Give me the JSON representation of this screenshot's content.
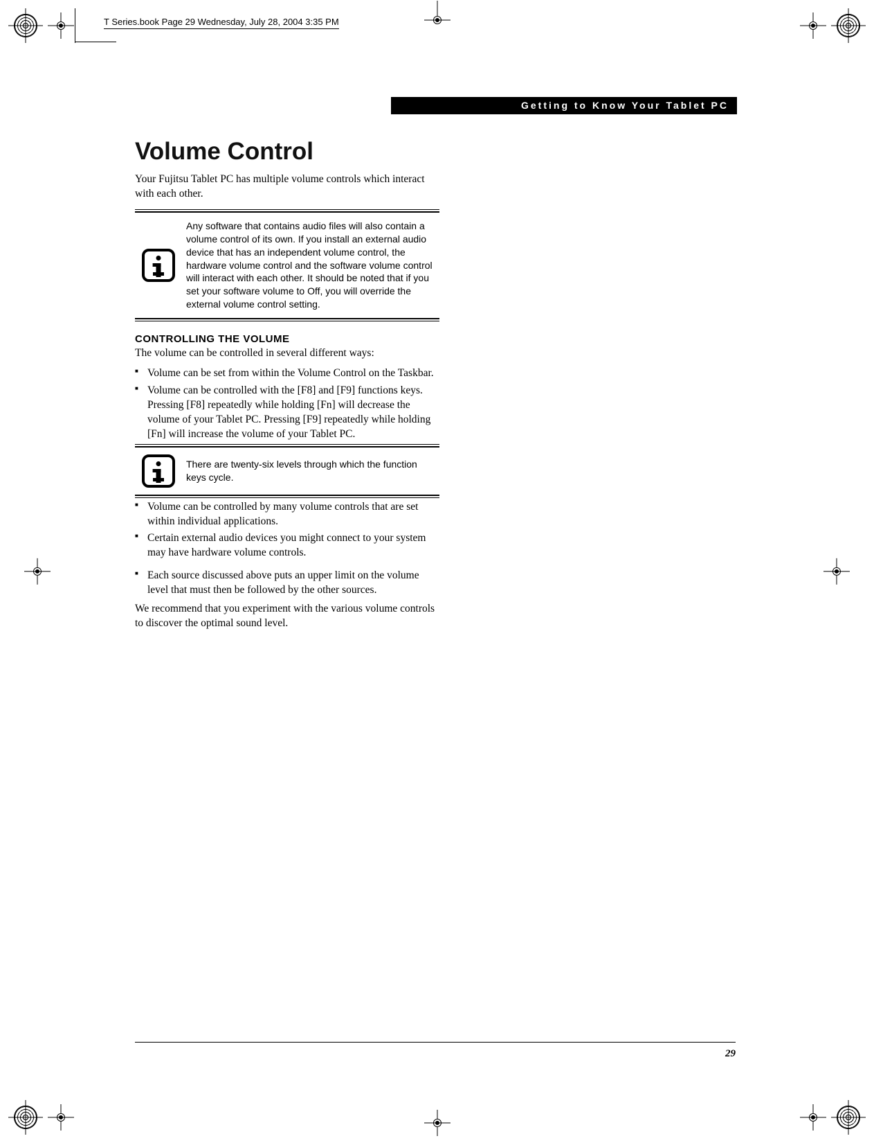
{
  "meta": {
    "header_stamp": "T Series.book  Page 29  Wednesday, July 28, 2004  3:35 PM"
  },
  "section_header": "Getting to Know Your Tablet PC",
  "title": "Volume Control",
  "intro": "Your Fujitsu Tablet PC has multiple volume controls which interact with each other.",
  "note1": "Any software that contains audio files will also contain a volume control of its own. If you install an external audio device that has an independent volume control, the hardware volume control and the software volume control will interact with each other. It should be noted that if you set your software volume to Off, you will override the external volume control setting.",
  "subheading": "CONTROLLING THE VOLUME",
  "sub_intro": "The volume can be controlled in several different ways:",
  "bullets1": {
    "b0": "Volume can be set from within the Volume Control on the Taskbar.",
    "b1": "Volume can be controlled with the [F8] and [F9] functions keys. Pressing [F8] repeatedly while holding [Fn] will decrease the volume of your Tablet PC. Pressing [F9] repeatedly while holding [Fn] will increase the volume of your Tablet PC."
  },
  "note2": "There are twenty-six levels through which the function keys cycle.",
  "bullets2": {
    "b0": "Volume can be controlled by many volume controls that are set within individual applications.",
    "b1": "Certain external audio devices you might connect to your system may have hardware volume controls.",
    "b2": "Each source discussed above puts an upper limit on the volume level that must then be followed by the other sources."
  },
  "closing": "We recommend that you experiment with the various volume controls to discover the optimal sound level.",
  "page_number": "29"
}
